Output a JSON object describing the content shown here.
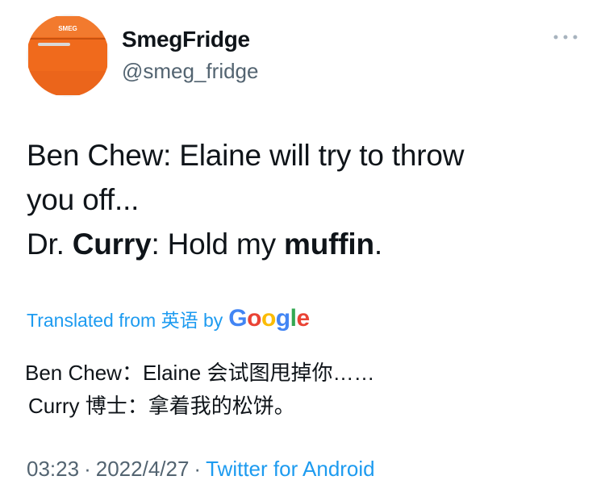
{
  "user": {
    "display_name": "SmegFridge",
    "handle": "@smeg_fridge",
    "avatar_brand": "SMEG",
    "avatar_color": "#f06a1c"
  },
  "tweet": {
    "line1": "Ben Chew: Elaine will try to throw",
    "line2": "you off...",
    "line3_prefix": "Dr. ",
    "line3_bold1": "Curry",
    "line3_mid": ": Hold my ",
    "line3_bold2": "muffin",
    "line3_suffix": "."
  },
  "translation": {
    "label": "Translated from 英语 by",
    "google": [
      "G",
      "o",
      "o",
      "g",
      "l",
      "e"
    ],
    "line1": "Ben Chew：Elaine 会试图甩掉你……",
    "line2": "Curry 博士：拿着我的松饼。"
  },
  "meta": {
    "time": "03:23",
    "separator": "·",
    "date": "2022/4/27",
    "source": "Twitter for Android"
  },
  "icons": {
    "more": "more-dots-icon",
    "avatar": "smeg-fridge-avatar"
  },
  "colors": {
    "link": "#1d9bf0",
    "muted": "#536471",
    "text": "#0f1419"
  }
}
